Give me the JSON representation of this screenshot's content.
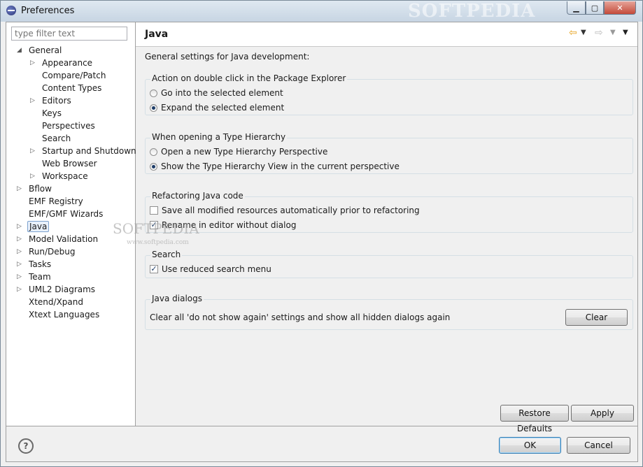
{
  "window": {
    "title": "Preferences",
    "watermark": "SOFTPEDIA",
    "minimize_icon": "minimize-icon",
    "maximize_icon": "maximize-icon",
    "close_icon": "close-icon"
  },
  "filter": {
    "placeholder": "type filter text"
  },
  "tree": [
    {
      "label": "General",
      "level": 0,
      "expander": "expanded"
    },
    {
      "label": "Appearance",
      "level": 1,
      "expander": "collapsed"
    },
    {
      "label": "Compare/Patch",
      "level": 1,
      "expander": "none"
    },
    {
      "label": "Content Types",
      "level": 1,
      "expander": "none"
    },
    {
      "label": "Editors",
      "level": 1,
      "expander": "collapsed"
    },
    {
      "label": "Keys",
      "level": 1,
      "expander": "none"
    },
    {
      "label": "Perspectives",
      "level": 1,
      "expander": "none"
    },
    {
      "label": "Search",
      "level": 1,
      "expander": "none"
    },
    {
      "label": "Startup and Shutdown",
      "level": 1,
      "expander": "collapsed"
    },
    {
      "label": "Web Browser",
      "level": 1,
      "expander": "none"
    },
    {
      "label": "Workspace",
      "level": 1,
      "expander": "collapsed"
    },
    {
      "label": "Bflow",
      "level": 0,
      "expander": "collapsed"
    },
    {
      "label": "EMF Registry",
      "level": 0,
      "expander": "none"
    },
    {
      "label": "EMF/GMF Wizards",
      "level": 0,
      "expander": "none"
    },
    {
      "label": "Java",
      "level": 0,
      "expander": "collapsed",
      "selected": true
    },
    {
      "label": "Model Validation",
      "level": 0,
      "expander": "collapsed"
    },
    {
      "label": "Run/Debug",
      "level": 0,
      "expander": "collapsed"
    },
    {
      "label": "Tasks",
      "level": 0,
      "expander": "collapsed"
    },
    {
      "label": "Team",
      "level": 0,
      "expander": "collapsed"
    },
    {
      "label": "UML2 Diagrams",
      "level": 0,
      "expander": "collapsed"
    },
    {
      "label": "Xtend/Xpand",
      "level": 0,
      "expander": "none"
    },
    {
      "label": "Xtext Languages",
      "level": 0,
      "expander": "none"
    }
  ],
  "page": {
    "title": "Java",
    "description": "General settings for Java development:",
    "double_click": {
      "title": "Action on double click in the Package Explorer",
      "options": [
        {
          "label": "Go into the selected element",
          "checked": false
        },
        {
          "label": "Expand the selected element",
          "checked": true
        }
      ]
    },
    "type_hierarchy": {
      "title": "When opening a Type Hierarchy",
      "options": [
        {
          "label": "Open a new Type Hierarchy Perspective",
          "checked": false
        },
        {
          "label": "Show the Type Hierarchy View in the current perspective",
          "checked": true
        }
      ]
    },
    "refactoring": {
      "title": "Refactoring Java code",
      "options": [
        {
          "label": "Save all modified resources automatically prior to refactoring",
          "checked": false
        },
        {
          "label": "Rename in editor without dialog",
          "checked": true
        }
      ]
    },
    "search": {
      "title": "Search",
      "options": [
        {
          "label": "Use reduced search menu",
          "checked": true
        }
      ]
    },
    "dialogs": {
      "title": "Java dialogs",
      "text": "Clear all 'do not show again' settings and show all hidden dialogs again",
      "clear_label": "Clear"
    },
    "restore_label": "Restore Defaults",
    "apply_label": "Apply"
  },
  "bottom": {
    "help_icon": "help-icon",
    "ok_label": "OK",
    "cancel_label": "Cancel"
  },
  "watermark_center": {
    "text": "SOFTPEDIA",
    "sub": "www.softpedia.com"
  }
}
